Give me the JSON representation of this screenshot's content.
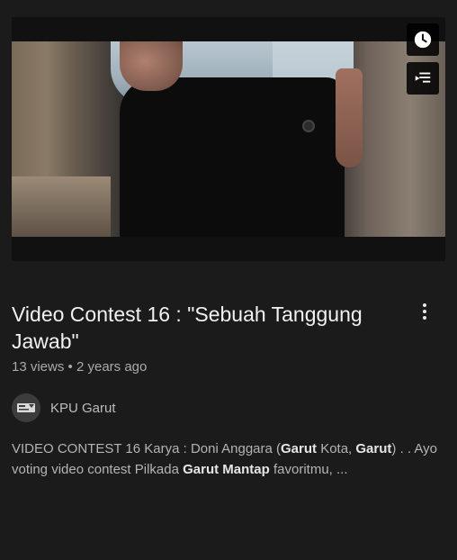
{
  "video": {
    "title": "Video Contest 16 : \"Sebuah Tanggung Jawab\"",
    "views": "13 views",
    "separator": "•",
    "age": "2 years ago"
  },
  "channel": {
    "name": "KPU Garut"
  },
  "description": {
    "segments": [
      {
        "text": "VIDEO CONTEST 16 Karya : Doni Anggara (",
        "bold": false
      },
      {
        "text": "Garut",
        "bold": true
      },
      {
        "text": " Kota, ",
        "bold": false
      },
      {
        "text": "Garut",
        "bold": true
      },
      {
        "text": ") . . Ayo voting video contest Pilkada ",
        "bold": false
      },
      {
        "text": "Garut Mantap",
        "bold": true
      },
      {
        "text": " favoritmu, ...",
        "bold": false
      }
    ]
  },
  "overlay": {
    "watch_later_icon": "clock-icon",
    "add_to_queue_icon": "queue-icon"
  },
  "colors": {
    "background": "#1b1b1b",
    "title": "#f1f1f1",
    "meta": "#aaaaaa"
  }
}
